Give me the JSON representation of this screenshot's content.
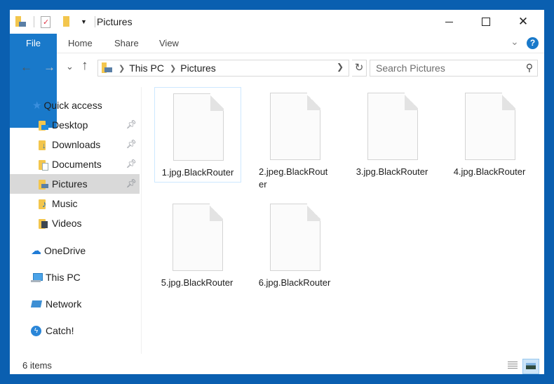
{
  "window": {
    "title": "Pictures",
    "controls": {
      "minimize": "minimize-icon",
      "maximize": "maximize-icon",
      "close": "close-icon"
    },
    "frame_color": "#0a5fb0"
  },
  "quick_access_toolbar": {
    "icons": [
      "folder-pictures-icon",
      "properties-icon",
      "new-folder-icon",
      "chevron-down-icon"
    ]
  },
  "ribbon": {
    "tabs": [
      {
        "label": "File",
        "active": true
      },
      {
        "label": "Home"
      },
      {
        "label": "Share"
      },
      {
        "label": "View"
      }
    ],
    "accent": "#1979ca",
    "help": "?"
  },
  "navigation": {
    "back": "←",
    "forward": "→",
    "recent": "⌄",
    "up": "↑",
    "breadcrumb": [
      "This PC",
      "Pictures"
    ],
    "search_placeholder": "Search Pictures"
  },
  "sidebar": {
    "quick_access": "Quick access",
    "pinned": [
      {
        "label": "Desktop",
        "pinned": true
      },
      {
        "label": "Downloads",
        "pinned": true
      },
      {
        "label": "Documents",
        "pinned": true
      },
      {
        "label": "Pictures",
        "pinned": true,
        "selected": true
      },
      {
        "label": "Music",
        "pinned": false
      },
      {
        "label": "Videos",
        "pinned": false
      }
    ],
    "locations": [
      {
        "label": "OneDrive"
      },
      {
        "label": "This PC"
      },
      {
        "label": "Network"
      },
      {
        "label": "Catch!"
      }
    ]
  },
  "files": [
    {
      "name": "1.jpg.BlackRouter",
      "selected": true
    },
    {
      "name": "2.jpeg.BlackRouter"
    },
    {
      "name": "3.jpg.BlackRouter"
    },
    {
      "name": "4.jpg.BlackRouter"
    },
    {
      "name": "5.jpg.BlackRouter"
    },
    {
      "name": "6.jpg.BlackRouter"
    }
  ],
  "status_bar": {
    "item_count": "6 items",
    "views": [
      "details-view",
      "large-icons-view"
    ],
    "active_view": "large-icons-view"
  }
}
